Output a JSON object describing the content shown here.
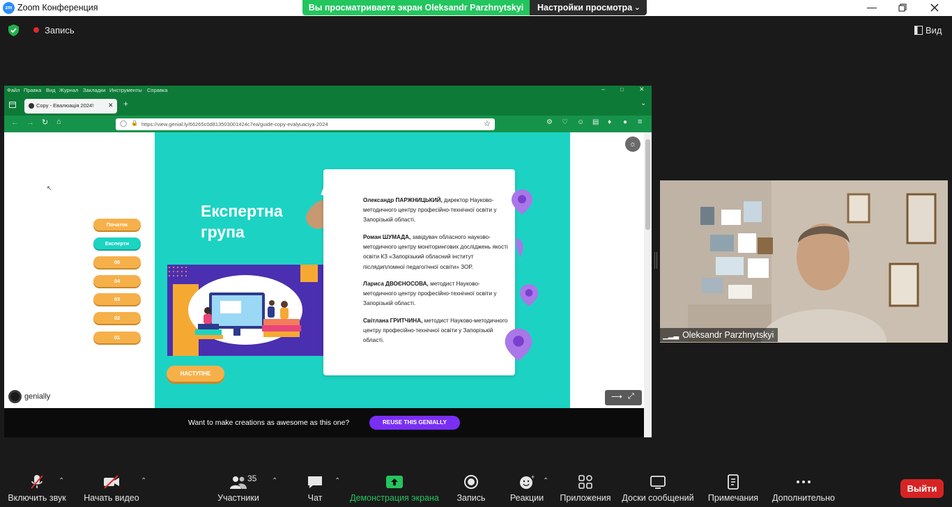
{
  "window": {
    "app_title": "Zoom Конференция",
    "logo_text": "zm"
  },
  "banner": {
    "viewing_text": "Вы просматриваете экран Oleksandr Parzhnytskyi",
    "view_settings": "Настройки просмотра"
  },
  "topbar": {
    "recording_label": "Запись",
    "view_label": "Вид"
  },
  "browser": {
    "menu": [
      "Файл",
      "Правка",
      "Вид",
      "Журнал",
      "Закладки",
      "Инструменты",
      "Справка"
    ],
    "tab_title": "Copy - Евалюація 2024!",
    "url": "https://view.genial.ly/66265c0d813503001424c7ea/guide-copy-evalyuaciya-2024"
  },
  "genially": {
    "nav_buttons": [
      {
        "label": "Початок",
        "active": false
      },
      {
        "label": "Експерти",
        "active": true
      },
      {
        "label": "05",
        "active": false
      },
      {
        "label": "04",
        "active": false
      },
      {
        "label": "03",
        "active": false
      },
      {
        "label": "02",
        "active": false
      },
      {
        "label": "01",
        "active": false
      }
    ],
    "slide_title_line1": "Експертна",
    "slide_title_line2": "група",
    "next_button": "НАСТУПНЕ",
    "experts": [
      {
        "name": "Олександр ПАРЖНИЦЬКИЙ,",
        "desc": " директор Науково-методичного центру професійно-технічної освіти у Запорізькій області."
      },
      {
        "name": "Роман ШУМАДА,",
        "desc": "  завідувач обласного науково-методичного центру моніторингових досліджень якості освіти КЗ «Запорізький обласний інститут післядипломної педагогічної освіти» ЗОР."
      },
      {
        "name": "Лариса ДВОЄНОСОВА,",
        "desc": " методист Науково-методичного центру професійно-технічної освіти у Запорізькій області."
      },
      {
        "name": "Світлана ГРИТЧИНА,",
        "desc": " методист Науково-методичного центру професійно-технічної освіти у Запорізькій області."
      }
    ],
    "brand": "genially",
    "cta_text": "Want to make creations as awesome as this one?",
    "cta_button": "REUSE THIS GENIALLY"
  },
  "video": {
    "participant_name": "Oleksandr Parzhnytskyi"
  },
  "toolbar": {
    "unmute": "Включить звук",
    "start_video": "Начать видео",
    "participants": "Участники",
    "participants_count": "35",
    "chat": "Чат",
    "share_screen": "Демонстрация экрана",
    "record": "Запись",
    "reactions": "Реакции",
    "apps": "Приложения",
    "whiteboards": "Доски сообщений",
    "notes": "Примечания",
    "more": "Дополнительно",
    "leave": "Выйти"
  },
  "colors": {
    "zoom_bg": "#1a1a1a",
    "banner_green": "#23c55e",
    "browser_green": "#0e7a38",
    "slide_teal": "#1cd3c3",
    "pill_orange": "#f6b04a",
    "cta_purple": "#7a2ff5",
    "leave_red": "#d62424"
  }
}
